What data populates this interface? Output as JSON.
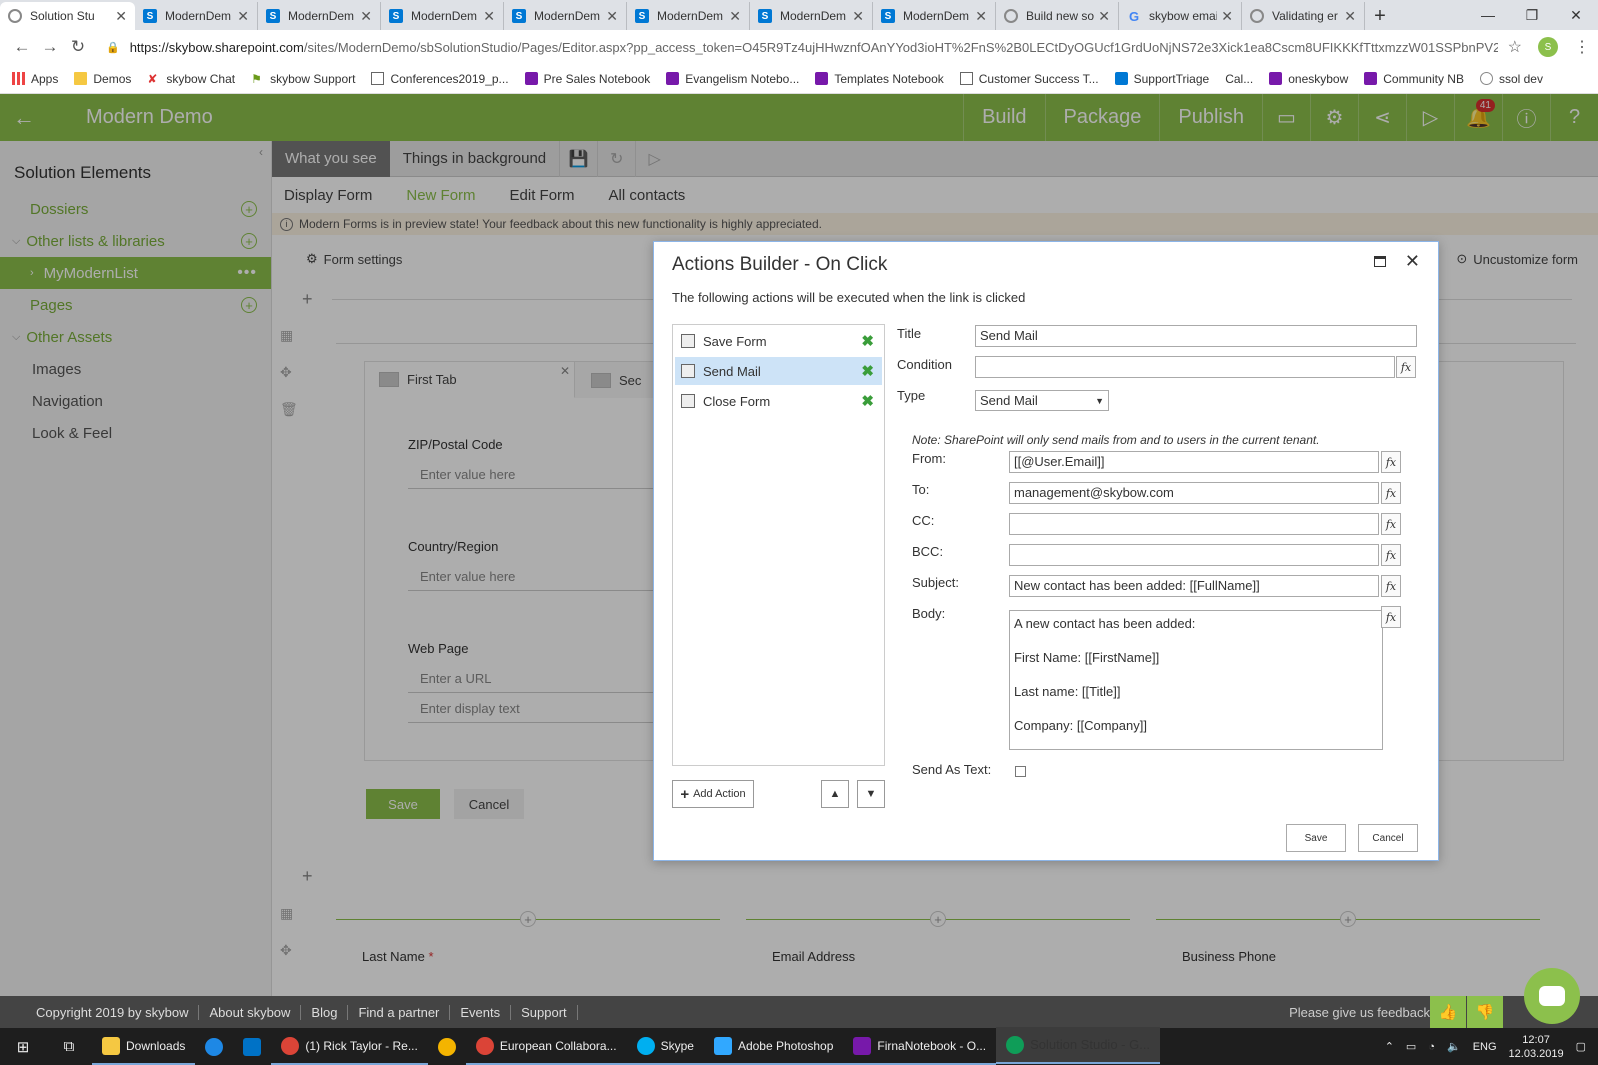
{
  "browser": {
    "tabs": [
      {
        "title": "Solution Stu",
        "icon": "solution-studio-icon",
        "active": true
      },
      {
        "title": "ModernDem",
        "icon": "sharepoint-icon"
      },
      {
        "title": "ModernDem",
        "icon": "sharepoint-icon"
      },
      {
        "title": "ModernDem",
        "icon": "sharepoint-icon"
      },
      {
        "title": "ModernDem",
        "icon": "sharepoint-icon"
      },
      {
        "title": "ModernDem",
        "icon": "sharepoint-icon"
      },
      {
        "title": "ModernDem",
        "icon": "sharepoint-icon"
      },
      {
        "title": "ModernDem",
        "icon": "sharepoint-icon"
      },
      {
        "title": "Build new sol",
        "icon": "solution-studio-icon"
      },
      {
        "title": "skybow emai",
        "icon": "google-icon"
      },
      {
        "title": "Validating er",
        "icon": "solution-studio-icon"
      }
    ],
    "url_host": "https://skybow.sharepoint.com",
    "url_path": "/sites/ModernDemo/sbSolutionStudio/Pages/Editor.aspx?pp_access_token=O45R9Tz4ujHHwznfOAnYYod3ioHT%2FnS%2B0LECtDyOGUcf1GrdUoNjNS72e3Xick1ea8Cscm8UFIKKKfTttxmzzW01SSPbnPV2U...",
    "bookmarks": [
      "Apps",
      "Demos",
      "skybow Chat",
      "skybow Support",
      "Conferences2019_p...",
      "Pre Sales Notebook",
      "Evangelism Notebo...",
      "Templates Notebook",
      "Customer Success T...",
      "SupportTriage",
      "Cal...",
      "oneskybow",
      "Community NB",
      "ssol dev"
    ]
  },
  "app": {
    "title": "Modern Demo",
    "nav": {
      "build": "Build",
      "package": "Package",
      "publish": "Publish"
    },
    "notification_count": "41"
  },
  "sidebar": {
    "title": "Solution Elements",
    "items": [
      {
        "label": "Dossiers"
      },
      {
        "label": "Other lists & libraries"
      },
      {
        "label": "MyModernList"
      },
      {
        "label": "Pages"
      },
      {
        "label": "Other Assets"
      },
      {
        "label": "Images"
      },
      {
        "label": "Navigation"
      },
      {
        "label": "Look & Feel"
      }
    ]
  },
  "main": {
    "view_tabs": [
      "What you see",
      "Things in background"
    ],
    "form_tabs": [
      "Display Form",
      "New Form",
      "Edit Form",
      "All contacts"
    ],
    "preview_banner": "Modern Forms is in preview state! Your feedback about this new functionality is highly appreciated.",
    "form_settings": "Form settings",
    "uncustomize": "Uncustomize form",
    "tab1": "First Tab",
    "tab2": "Sec",
    "fields": [
      {
        "label": "ZIP/Postal Code",
        "placeholder": "Enter value here"
      },
      {
        "label": "Country/Region",
        "placeholder": "Enter value here"
      },
      {
        "label": "Web Page",
        "placeholder": "Enter a URL",
        "placeholder2": "Enter display text"
      }
    ],
    "save": "Save",
    "cancel": "Cancel",
    "bottom_fields": [
      "Last Name",
      "Email Address",
      "Business Phone"
    ],
    "required_mark": "*"
  },
  "dialog": {
    "title": "Actions Builder - On Click",
    "subtitle": "The following actions will be executed when the link is clicked",
    "actions": [
      "Save Form",
      "Send Mail",
      "Close Form"
    ],
    "add_action": "Add Action",
    "labels": {
      "title": "Title",
      "condition": "Condition",
      "type": "Type",
      "from": "From:",
      "to": "To:",
      "cc": "CC:",
      "bcc": "BCC:",
      "subject": "Subject:",
      "body": "Body:",
      "send_as_text": "Send As Text:"
    },
    "values": {
      "title": "Send Mail",
      "condition": "",
      "type": "Send Mail",
      "from": "[[@User.Email]]",
      "to": "management@skybow.com",
      "cc": "",
      "bcc": "",
      "subject": "New contact has been added: [[FullName]]"
    },
    "body_lines": [
      "A new contact has been added:",
      "First Name: [[FirstName]]",
      "Last name: [[Title]]",
      "Company: [[Company]]"
    ],
    "note": "Note: SharePoint will only send mails from and to users in the current tenant.",
    "save": "Save",
    "cancel": "Cancel"
  },
  "footer": {
    "links": [
      "Copyright 2019 by skybow",
      "About skybow",
      "Blog",
      "Find a partner",
      "Events",
      "Support"
    ],
    "feedback": "Please give us feedback"
  },
  "taskbar": {
    "items": [
      "Downloads",
      "(1) Rick Taylor - Re...",
      "European Collabora...",
      "Skype",
      "Adobe Photoshop",
      "FirnaNotebook - O...",
      "Solution Studio - G..."
    ],
    "lang": "ENG",
    "time": "12:07",
    "date": "12.03.2019"
  }
}
